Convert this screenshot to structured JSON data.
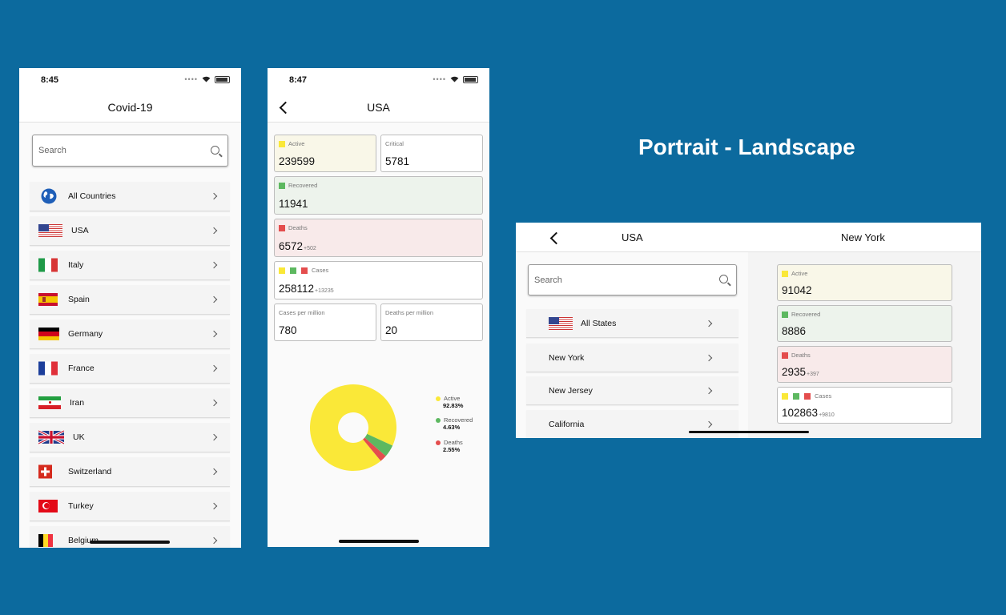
{
  "colors": {
    "background": "#0C6A9E",
    "active": "#FAE838",
    "recovered": "#5DB860",
    "deaths": "#E44D4D"
  },
  "heading": "Portrait - Landscape",
  "list_screen": {
    "time": "8:45",
    "title": "Covid-19",
    "search_placeholder": "Search",
    "items": [
      {
        "label": "All Countries",
        "icon": "globe-icon"
      },
      {
        "label": "USA",
        "icon": "usa-flag-icon"
      },
      {
        "label": "Italy",
        "icon": "italy-flag-icon"
      },
      {
        "label": "Spain",
        "icon": "spain-flag-icon"
      },
      {
        "label": "Germany",
        "icon": "germany-flag-icon"
      },
      {
        "label": "France",
        "icon": "france-flag-icon"
      },
      {
        "label": "Iran",
        "icon": "iran-flag-icon"
      },
      {
        "label": "UK",
        "icon": "uk-flag-icon"
      },
      {
        "label": "Switzerland",
        "icon": "switzerland-flag-icon"
      },
      {
        "label": "Turkey",
        "icon": "turkey-flag-icon"
      },
      {
        "label": "Belgium",
        "icon": "belgium-flag-icon"
      }
    ]
  },
  "detail_screen": {
    "time": "8:47",
    "title": "USA",
    "cards": {
      "active": {
        "label": "Active",
        "value": "239599"
      },
      "critical": {
        "label": "Critical",
        "value": "5781"
      },
      "recovered": {
        "label": "Recovered",
        "value": "11941"
      },
      "deaths": {
        "label": "Deaths",
        "value": "6572",
        "delta": "+502"
      },
      "cases": {
        "label": "Cases",
        "value": "258112",
        "delta": "+13235"
      },
      "cases_per_million": {
        "label": "Cases per million",
        "value": "780"
      },
      "deaths_per_million": {
        "label": "Deaths per million",
        "value": "20"
      }
    },
    "donut": {
      "segments": [
        {
          "label": "Active",
          "value_text": "92.83%",
          "percent": 92.83,
          "color": "#FAE838"
        },
        {
          "label": "Recovered",
          "value_text": "4.63%",
          "percent": 4.63,
          "color": "#5DB860"
        },
        {
          "label": "Deaths",
          "value_text": "2.55%",
          "percent": 2.55,
          "color": "#E44D4D"
        }
      ]
    }
  },
  "landscape": {
    "left_title": "USA",
    "right_title": "New York",
    "search_placeholder": "Search",
    "items": [
      {
        "label": "All States",
        "icon": "usa-flag-icon"
      },
      {
        "label": "New York"
      },
      {
        "label": "New Jersey"
      },
      {
        "label": "California"
      }
    ],
    "cards": {
      "active": {
        "label": "Active",
        "value": "91042"
      },
      "recovered": {
        "label": "Recovered",
        "value": "8886"
      },
      "deaths": {
        "label": "Deaths",
        "value": "2935",
        "delta": "+397"
      },
      "cases": {
        "label": "Cases",
        "value": "102863",
        "delta": "+9810"
      }
    }
  }
}
